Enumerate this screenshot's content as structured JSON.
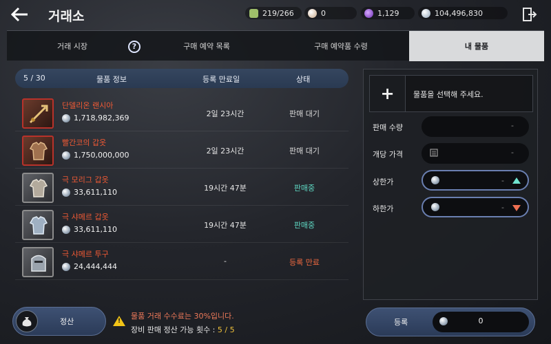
{
  "header": {
    "title": "거래소",
    "stats": {
      "energy": "219/266",
      "pearl": "0",
      "orb": "1,129",
      "silver": "104,496,830"
    }
  },
  "tabs": [
    {
      "label": "거래 시장",
      "active": false
    },
    {
      "label": "구매 예약 목록",
      "active": false
    },
    {
      "label": "구매 예약품 수령",
      "active": false
    },
    {
      "label": "내 물품",
      "active": true
    }
  ],
  "list": {
    "count": "5 / 30",
    "columns": {
      "info": "물품 정보",
      "expire": "등록 만료일",
      "status": "상태"
    },
    "items": [
      {
        "name": "단델리온 랜시아",
        "price": "1,718,982,369",
        "expire": "2일 23시간",
        "status": "판매 대기"
      },
      {
        "name": "빨간코의 갑옷",
        "price": "1,750,000,000",
        "expire": "2일 23시간",
        "status": "판매 대기"
      },
      {
        "name": "극 모리그 갑옷",
        "price": "33,611,110",
        "expire": "19시간 47분",
        "status": "판매중"
      },
      {
        "name": "극 샤메르 갑옷",
        "price": "33,611,110",
        "expire": "19시간 47분",
        "status": "판매중"
      },
      {
        "name": "극 샤메르 투구",
        "price": "24,444,444",
        "expire": "-",
        "status": "등록 만료"
      }
    ]
  },
  "register_panel": {
    "select_prompt": "물품을 선택해 주세요.",
    "quantity_label": "판매 수량",
    "quantity_value": "-",
    "unit_price_label": "개당 가격",
    "unit_price_value": "-",
    "max_price_label": "상한가",
    "max_price_value": "-",
    "min_price_label": "하한가",
    "min_price_value": "-"
  },
  "footer": {
    "settle_label": "정산",
    "notice_fee": "물품 거래 수수료는 30%입니다.",
    "notice_count_prefix": "장비 판매 정산 가능 횟수 : ",
    "notice_count_value": "5 / 5",
    "register_label": "등록",
    "register_amount": "0"
  },
  "colors": {
    "item_name": "#f05a35",
    "status_waiting": "#d9d9d9",
    "status_selling": "#5fd9c4",
    "status_expired": "#f06a3f",
    "accent": "#3e5173"
  }
}
